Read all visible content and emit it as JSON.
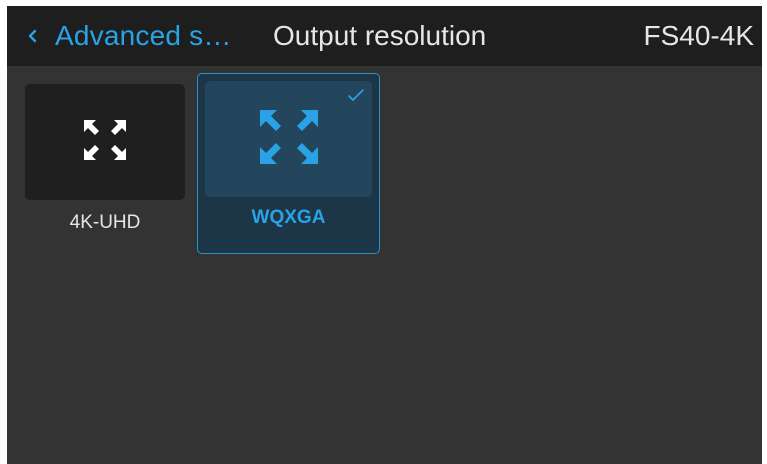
{
  "header": {
    "back_label": "Advanced s…",
    "title": "Output resolution",
    "device": "FS40-4K"
  },
  "options": [
    {
      "label": "4K-UHD",
      "icon": "expand-arrows-icon",
      "selected": false
    },
    {
      "label": "WQXGA",
      "icon": "expand-arrows-icon",
      "selected": true
    }
  ],
  "colors": {
    "accent": "#2aa3e6",
    "header_bg": "#1e1e1e",
    "screen_bg": "#333333",
    "tile_bg": "#1f1f1f",
    "selected_tile_bg": "#1c3547"
  }
}
